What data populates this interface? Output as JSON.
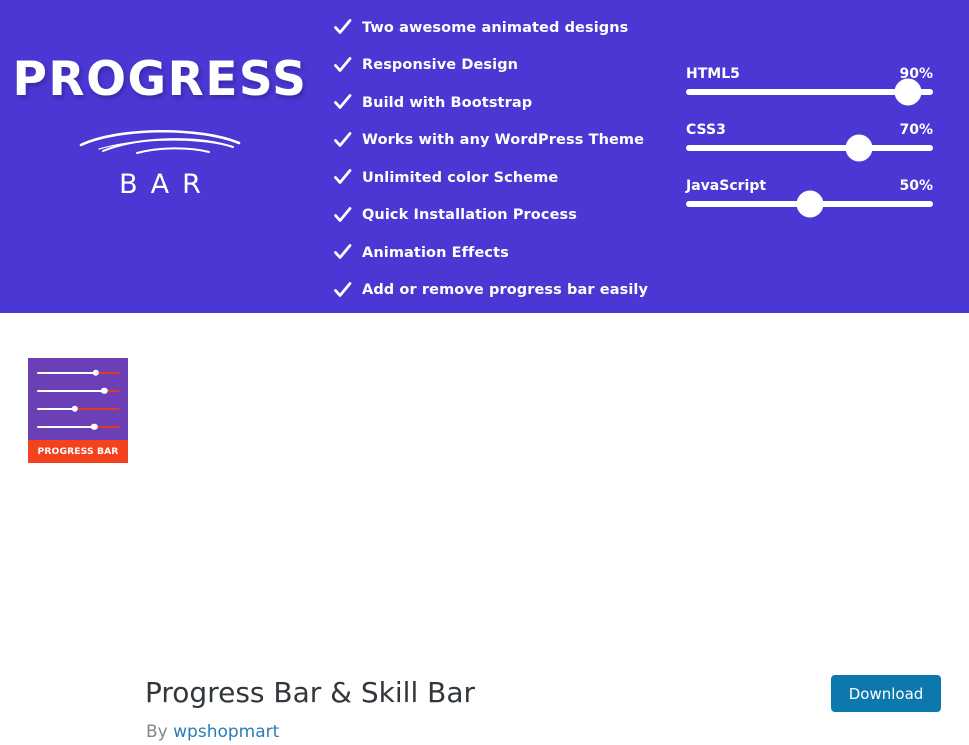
{
  "banner": {
    "background_color": "#4A37D4",
    "logo": {
      "word": "PROGRESS",
      "subword": "BAR",
      "swoosh_icon": "swoosh-underline-icon"
    },
    "features": [
      {
        "check_icon": "checkmark-icon",
        "label": "Two awesome animated designs"
      },
      {
        "check_icon": "checkmark-icon",
        "label": "Responsive Design"
      },
      {
        "check_icon": "checkmark-icon",
        "label": "Build with Bootstrap"
      },
      {
        "check_icon": "checkmark-icon",
        "label": "Works with any WordPress Theme"
      },
      {
        "check_icon": "checkmark-icon",
        "label": "Unlimited color Scheme"
      },
      {
        "check_icon": "checkmark-icon",
        "label": "Quick Installation Process"
      },
      {
        "check_icon": "checkmark-icon",
        "label": "Animation Effects"
      },
      {
        "check_icon": "checkmark-icon",
        "label": "Add or remove progress bar easily"
      }
    ],
    "skills": [
      {
        "name": "HTML5",
        "percent_label": "90%",
        "percent": 90
      },
      {
        "name": "CSS3",
        "percent_label": "70%",
        "percent": 70
      },
      {
        "name": "JavaScript",
        "percent_label": "50%",
        "percent": 50
      }
    ]
  },
  "plugin": {
    "icon": {
      "background_color": "#6B3FB5",
      "footer_color": "#F4421E",
      "footer_text": "PROGRESS BAR",
      "bars": [
        {
          "fill_percent": 72
        },
        {
          "fill_percent": 82
        },
        {
          "fill_percent": 46
        },
        {
          "fill_percent": 70
        }
      ]
    },
    "title": "Progress Bar & Skill Bar",
    "byline_prefix": "By ",
    "author": "wpshopmart",
    "download_label": "Download",
    "download_color": "#0D78AE",
    "author_link_color": "#2B7CB5"
  }
}
